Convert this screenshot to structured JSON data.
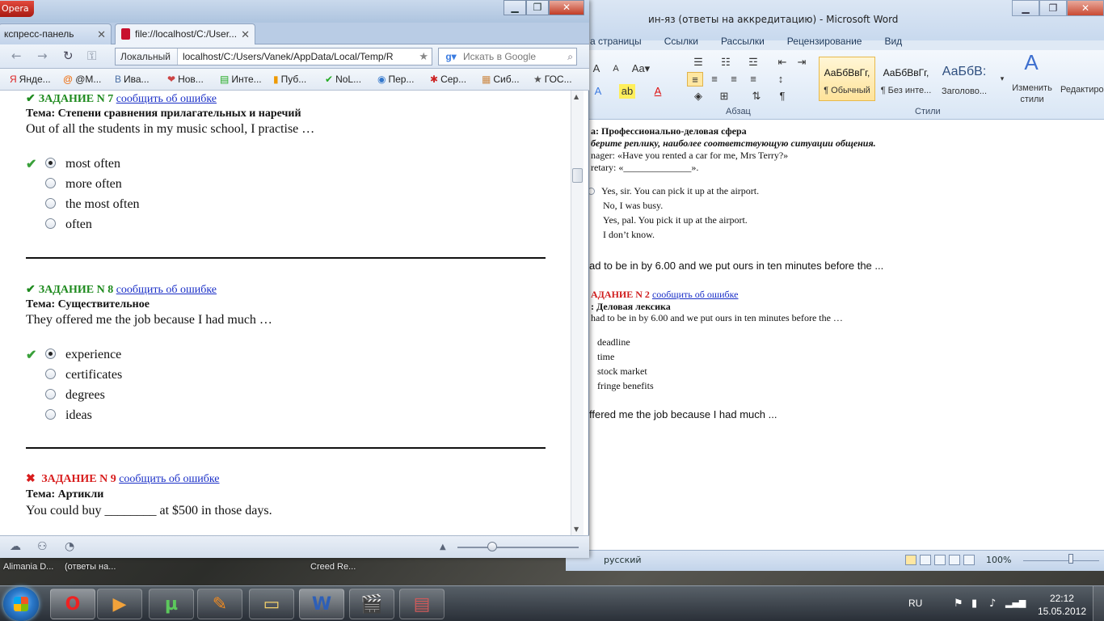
{
  "word": {
    "title": "ин-яз (ответы на аккредитацию) - Microsoft Word",
    "tabs": [
      "а страницы",
      "Ссылки",
      "Рассылки",
      "Рецензирование",
      "Вид"
    ],
    "groups": {
      "paragraph": "Абзац",
      "styles": "Стили"
    },
    "styles": [
      {
        "sample": "АаБбВвГг,",
        "name": "¶ Обычный"
      },
      {
        "sample": "АаБбВвГг,",
        "name": "¶ Без инте..."
      },
      {
        "sample": "АаБбВ:",
        "name": "Заголово..."
      }
    ],
    "change_styles": "Изменить стили",
    "edit_label": "Редактиров",
    "doc": {
      "l1": "а: Профессионально-деловая сфера",
      "l2": "берите реплику, наиболее соответствующую ситуации общения.",
      "l3": "nager: «Have you rented a car for me, Mrs Terry?»",
      "l4": "retary: «______________».",
      "opts1": [
        "Yes, sir. You can pick it up at the airport.",
        "No, I was busy.",
        "Yes, pal. You pick it up at the airport.",
        "I don’t know."
      ],
      "l5": "ad to be in by 6.00  and we put ours in ten minutes before the ...",
      "task2": "АДАНИЕ N 2",
      "report": "сообщить об ошибке",
      "topic2": ": Деловая лексика",
      "l6": "had to be in by 6.00 and we put ours in ten minutes before the …",
      "opts2": [
        "deadline",
        "time",
        "stock market",
        "fringe benefits"
      ],
      "l7": "ffered me the job because I had much ..."
    },
    "status": {
      "lang": "русский",
      "zoom": "100%"
    }
  },
  "opera": {
    "logo": "Opera",
    "tabs": [
      {
        "label": "кспресс-панель"
      },
      {
        "label": "file://localhost/C:/User..."
      }
    ],
    "address": {
      "local": "Локальный",
      "url": "localhost/C:/Users/Vanek/AppData/Local/Temp/R"
    },
    "search_placeholder": "Искать в Google",
    "bookmarks": [
      "Янде...",
      "@M...",
      "Ива...",
      "Нов...",
      "Инте...",
      "Пуб...",
      "NoL...",
      "Пер...",
      "Сер...",
      "Сиб...",
      "ГОС..."
    ],
    "report_link": "сообщить об ошибке",
    "tasks": [
      {
        "title": "ЗАДАНИЕ N 7",
        "topic": "Тема: Степени сравнения прилагательных и наречий",
        "question": "Out of all the students in my music school, I practise …",
        "options": [
          "most often",
          "more often",
          "the most often",
          "often"
        ]
      },
      {
        "title": "ЗАДАНИЕ N 8",
        "topic": "Тема: Существительное",
        "question": "They offered me the job because I had much …",
        "options": [
          "experience",
          "certificates",
          "degrees",
          "ideas"
        ]
      },
      {
        "title": "ЗАДАНИЕ N 9",
        "topic": "Тема: Артикли",
        "question": "You could buy ________ at $500 in those days."
      }
    ]
  },
  "strip": {
    "a": "Alimania D...",
    "b": "(ответы на...",
    "c": "Creed Re..."
  },
  "tray": {
    "lang": "RU",
    "time": "22:12",
    "date": "15.05.2012"
  }
}
